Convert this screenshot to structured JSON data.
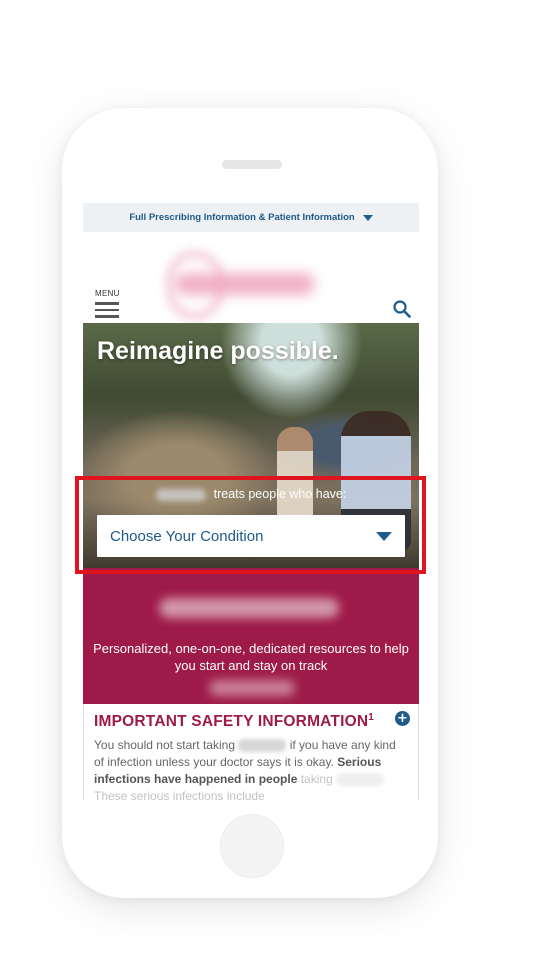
{
  "top_bar": {
    "pi_link": "Full Prescribing Information & Patient Information"
  },
  "header": {
    "menu_label": "MENU"
  },
  "hero": {
    "title": "Reimagine possible.",
    "treats_text": "treats people who have:",
    "condition_select": {
      "selected": "Choose Your Condition"
    }
  },
  "support_band": {
    "tagline": "Personalized, one-on-one, dedicated resources to help you start and stay on track"
  },
  "safety": {
    "title": "IMPORTANT SAFETY INFORMATION",
    "footnote": "1",
    "body_part1": "You should not start taking",
    "body_part2": "if you have any kind of infection unless your doctor says it is okay.",
    "body_bold": "Serious infections have happened in people",
    "body_part3": "taking",
    "body_part4": "These serious infections include"
  },
  "colors": {
    "brand_blue": "#1e5a8a",
    "magenta": "#9e1a48",
    "highlight_red": "#e0141e"
  },
  "icons": {
    "search": "search-icon",
    "menu": "hamburger-menu-icon",
    "expand": "plus-icon",
    "dropdown": "caret-down-icon"
  }
}
